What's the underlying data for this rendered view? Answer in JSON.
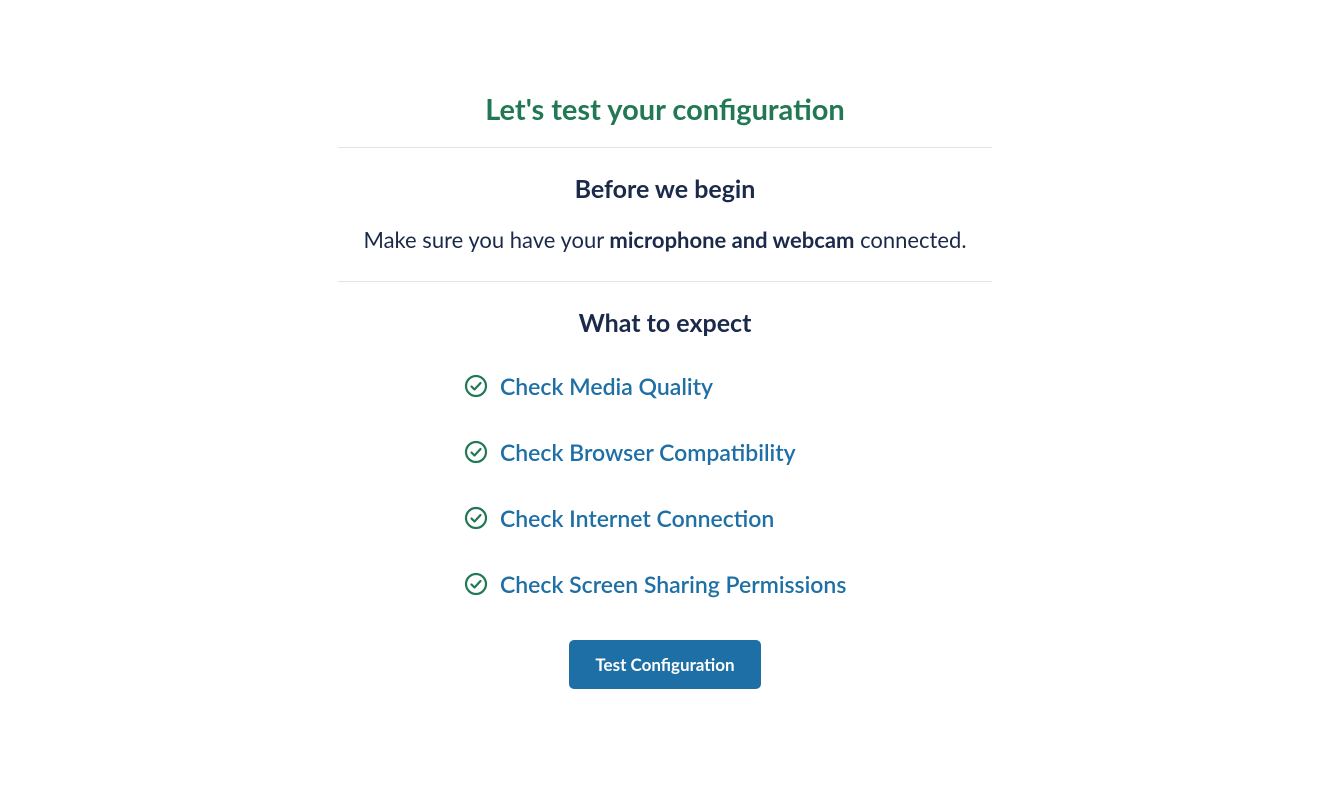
{
  "title": "Let's test your configuration",
  "before": {
    "heading": "Before we begin",
    "instruction_prefix": "Make sure you have your ",
    "instruction_bold": "microphone and webcam",
    "instruction_suffix": " connected."
  },
  "expect": {
    "heading": "What to expect",
    "items": [
      "Check Media Quality",
      "Check Browser Compatibility",
      "Check Internet Connection",
      "Check Screen Sharing Permissions"
    ]
  },
  "button_label": "Test Configuration"
}
